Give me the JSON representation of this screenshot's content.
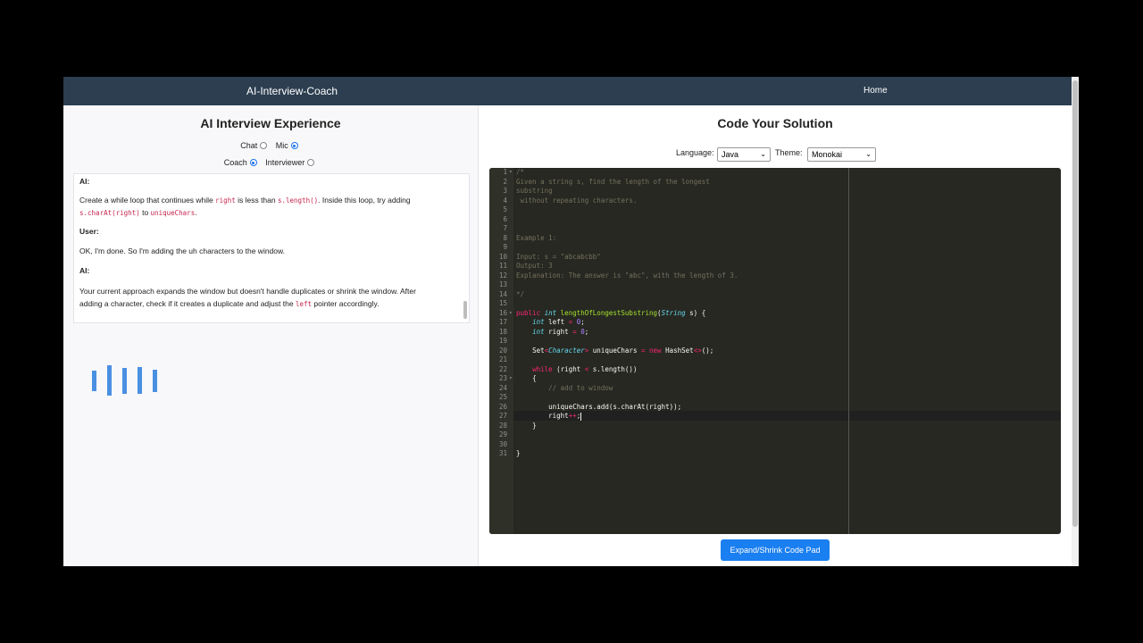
{
  "navbar": {
    "brand": "AI-Interview-Coach",
    "home": "Home"
  },
  "left": {
    "title": "AI Interview Experience",
    "input_mode": {
      "chat_label": "Chat",
      "mic_label": "Mic",
      "selected": "Mic"
    },
    "role_mode": {
      "coach_label": "Coach",
      "interviewer_label": "Interviewer",
      "selected": "Coach"
    },
    "chat": {
      "messages": [
        {
          "speaker": "AI:"
        },
        {
          "text_1": "Create a while loop that continues while ",
          "code_1": "right",
          "text_2": " is less than ",
          "code_2": "s.length()",
          "text_3": ". Inside this loop, try adding ",
          "code_3": "s.charAt(right)",
          "text_4": " to ",
          "code_4": "uniqueChars",
          "text_5": "."
        },
        {
          "speaker": "User:",
          "text": "OK, I'm done. So I'm adding the uh characters to the window."
        },
        {
          "speaker": "AI:",
          "text_1": "Your current approach expands the window but doesn't handle duplicates or shrink the window. After adding a character, check if it creates a duplicate and adjust the ",
          "code_1": "left",
          "text_2": " pointer accordingly."
        }
      ]
    },
    "visualizer_levels": [
      0.58,
      0.84,
      0.72,
      0.76,
      0.62
    ]
  },
  "right": {
    "title": "Code Your Solution",
    "language_label": "Language:",
    "language_value": "Java",
    "theme_label": "Theme:",
    "theme_value": "Monokai",
    "expand_button": "Expand/Shrink Code Pad",
    "editor": {
      "line_numbers": [
        "1",
        "2",
        "3",
        "4",
        "5",
        "6",
        "7",
        "8",
        "9",
        "10",
        "11",
        "12",
        "13",
        "14",
        "15",
        "16",
        "17",
        "18",
        "19",
        "20",
        "21",
        "22",
        "23",
        "24",
        "25",
        "26",
        "27",
        "28",
        "29",
        "30",
        "31"
      ],
      "fold_markers": [
        "▾",
        "▾",
        "▾",
        "▾"
      ],
      "lines": {
        "l1": "/*",
        "l2": "Given a string s, find the length of the longest",
        "l3": "substring",
        "l4": " without repeating characters.",
        "l9": "Example 1:",
        "l11": "Input: s = \"abcabcbb\"",
        "l12": "Output: 3",
        "l13": "Explanation: The answer is \"abc\", with the length of 3.",
        "l15": "*/",
        "l17_public": "public",
        "l17_int": "int",
        "l17_name": "lengthOfLongestSubstring",
        "l17_paren": "(",
        "l17_string": "String",
        "l17_rest": " s) {",
        "l18_int": "int",
        "l18_var": " left ",
        "l18_eq": "=",
        "l18_num": "0",
        "l18_semi": ";",
        "l19_int": "int",
        "l19_var": " right ",
        "l19_eq": "=",
        "l19_num": "0",
        "l19_semi": ";",
        "l21_set": "Set",
        "l21_lt": "<",
        "l21_char": "Character",
        "l21_gt": ">",
        "l21_var": " uniqueChars ",
        "l21_eq": "=",
        "l21_new": "new",
        "l21_hash": " HashSet",
        "l21_diamond": "<>",
        "l21_end": "();",
        "l23_while": "while",
        "l23_a": " (right ",
        "l23_lt": "<",
        "l23_b": " s.length())",
        "l24": "{",
        "l25": "// add to window",
        "l27": "uniqueChars.add(s.charAt(right));",
        "l28_var": "right",
        "l28_inc": "++",
        "l28_semi": ";",
        "l29": "}",
        "l32": "}"
      }
    }
  }
}
